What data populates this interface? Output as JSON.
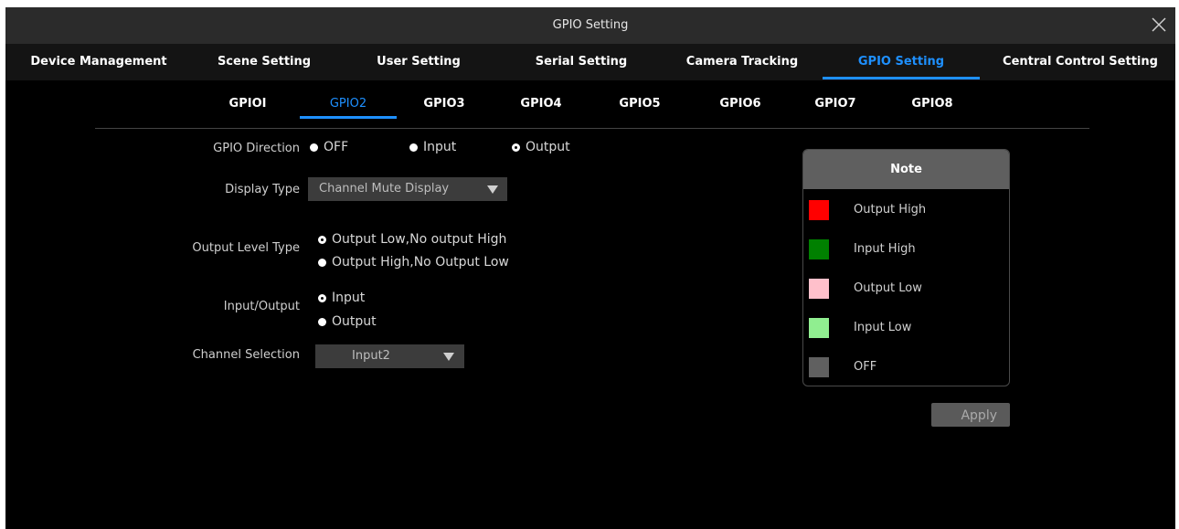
{
  "window": {
    "title": "GPIO Setting"
  },
  "main_tabs": [
    {
      "label": "Device Management"
    },
    {
      "label": "Scene Setting"
    },
    {
      "label": "User Setting"
    },
    {
      "label": "Serial Setting"
    },
    {
      "label": "Camera Tracking"
    },
    {
      "label": "GPIO Setting",
      "active": true
    },
    {
      "label": "Central Control Setting"
    }
  ],
  "gpio_tabs": [
    {
      "label": "GPIOI"
    },
    {
      "label": "GPIO2",
      "active": true
    },
    {
      "label": "GPIO3"
    },
    {
      "label": "GPIO4"
    },
    {
      "label": "GPIO5"
    },
    {
      "label": "GPIO6"
    },
    {
      "label": "GPIO7"
    },
    {
      "label": "GPIO8"
    }
  ],
  "form": {
    "gpio_direction": {
      "label": "GPIO Direction",
      "options": [
        "OFF",
        "Input",
        "Output"
      ],
      "selected": "Output"
    },
    "display_type": {
      "label": "Display Type",
      "value": "Channel Mute Display"
    },
    "output_level_type": {
      "label": "Output Level Type",
      "options": [
        "Output Low,No output High",
        "Output High,No Output Low"
      ],
      "selected": "Output Low,No output High"
    },
    "input_output": {
      "label": "Input/Output",
      "options": [
        "Input",
        "Output"
      ],
      "selected": "Input"
    },
    "channel_selection": {
      "label": "Channel Selection",
      "value": "Input2"
    }
  },
  "note": {
    "title": "Note",
    "items": [
      {
        "label": "Output High",
        "color": "#ff0000"
      },
      {
        "label": "Input High",
        "color": "#008000"
      },
      {
        "label": "Output Low",
        "color": "#ffc0cb"
      },
      {
        "label": "Input Low",
        "color": "#90ee90"
      },
      {
        "label": "OFF",
        "color": "#606060"
      }
    ]
  },
  "apply_label": "Apply"
}
